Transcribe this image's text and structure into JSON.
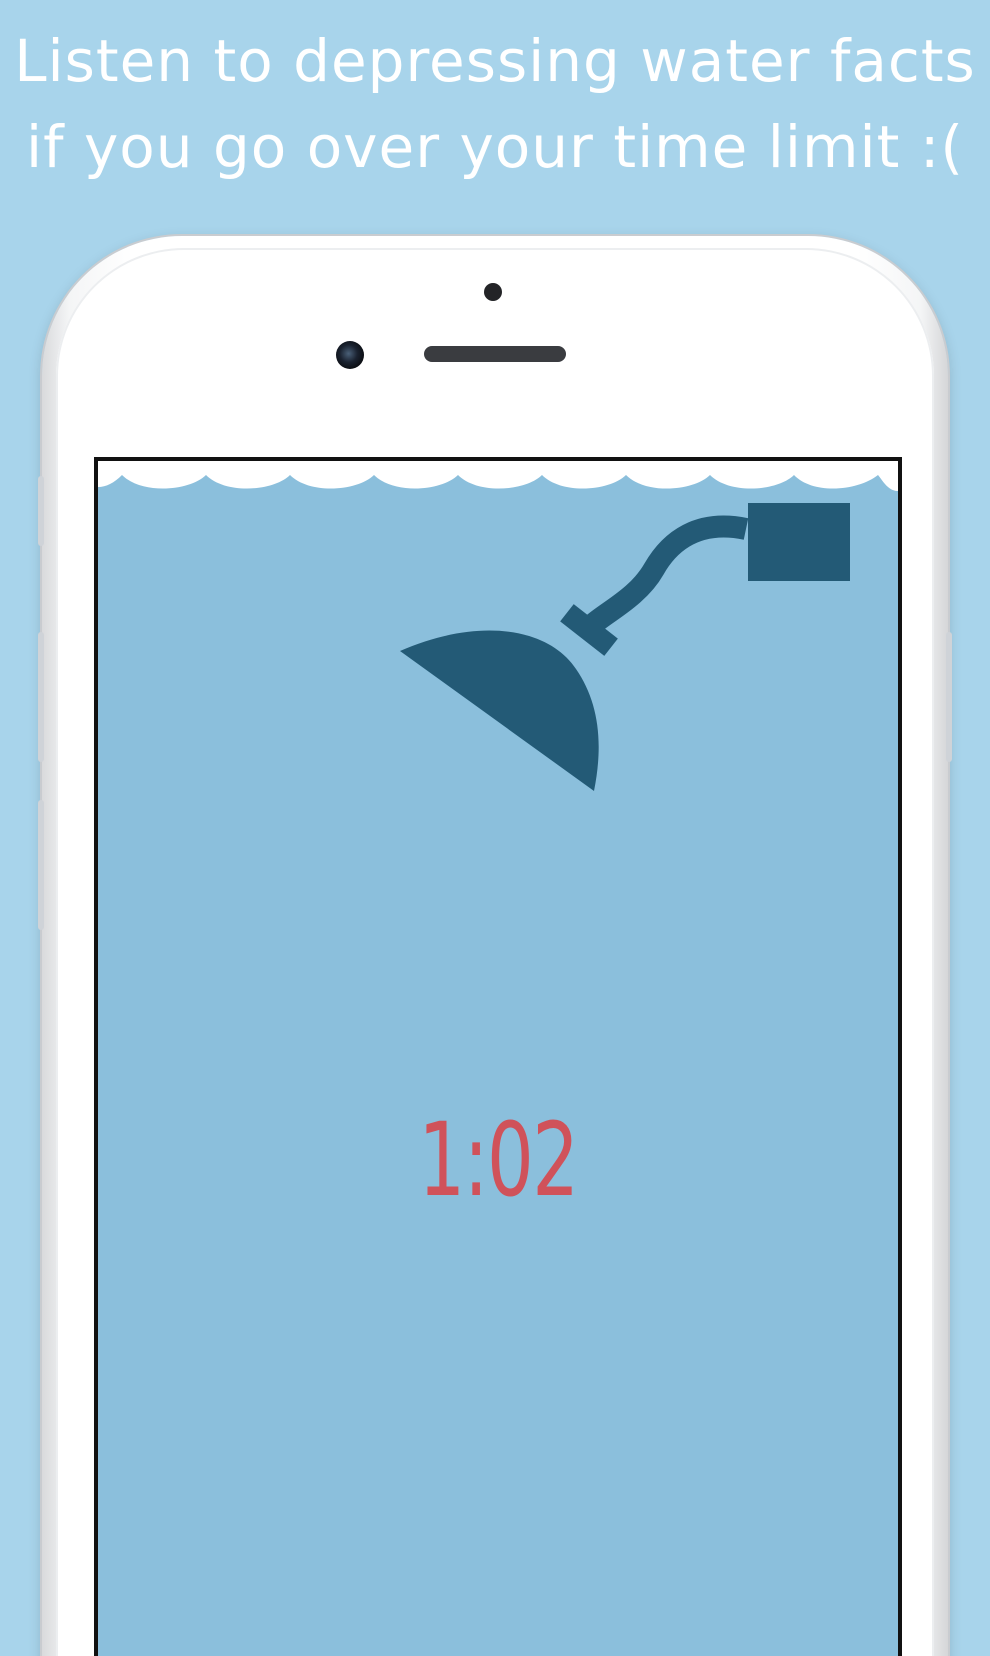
{
  "caption": {
    "line1": "Listen to depressing water facts",
    "line2": "if you go over your time limit :("
  },
  "app": {
    "timer_text": "1:02"
  },
  "icons": {
    "shower": "shower-head-icon"
  },
  "colors": {
    "background": "#a8d4eb",
    "screen": "#8bbfdc",
    "shower": "#235a76",
    "timer": "#d0525a",
    "wave": "#ffffff"
  }
}
